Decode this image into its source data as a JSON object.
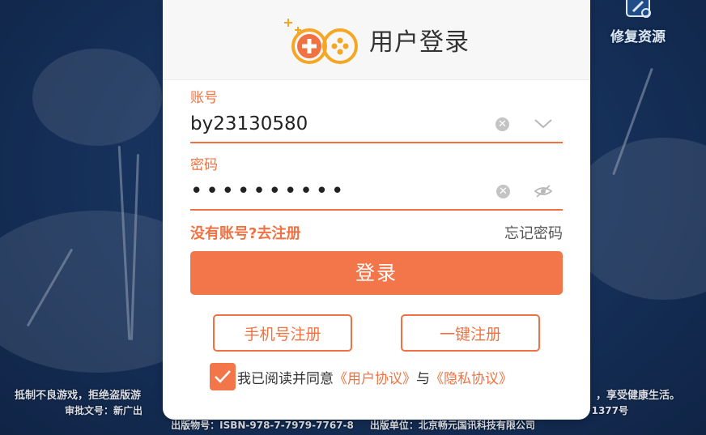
{
  "header": {
    "title": "用户登录",
    "repair_label": "修复资源"
  },
  "account": {
    "label": "账号",
    "value": "by23130580"
  },
  "password": {
    "label": "密码",
    "masked_value": "••••••••••"
  },
  "links": {
    "register": "没有账号?去注册",
    "forgot": "忘记密码"
  },
  "login_button": "登录",
  "register_options": {
    "phone": "手机号注册",
    "one_click": "一键注册"
  },
  "agreement": {
    "checked": true,
    "prefix": "我已阅读并同意",
    "user_agreement": "《用户协议》",
    "joiner": "与",
    "privacy_policy": "《隐私协议》"
  },
  "footer": {
    "line1_left": "抵制不良游戏，拒绝盗版游",
    "line1_right": "，享受健康生活。",
    "line2_left": "审批文号：新广出",
    "line2_right": "1377号",
    "publish_no": "出版物号：ISBN-978-7-7979-7767-8",
    "publisher": "出版单位：北京畅元国讯科技有限公司"
  },
  "colors": {
    "accent": "#f07242",
    "button": "#f3764a"
  },
  "icons": {
    "logo": "gamepad-plus-logo",
    "repair": "edit-gear-icon",
    "clear": "clear-circle-icon",
    "dropdown": "chevron-down-icon",
    "visibility": "eye-off-icon",
    "checkbox": "checkmark-icon"
  }
}
